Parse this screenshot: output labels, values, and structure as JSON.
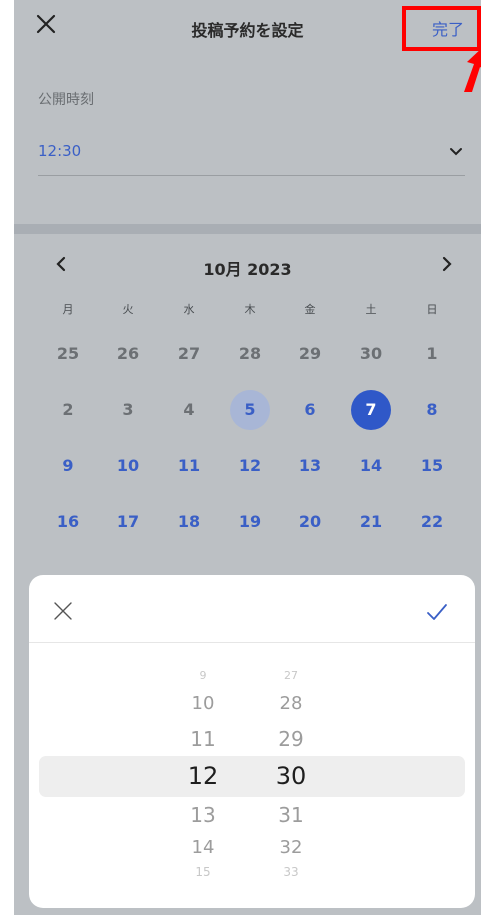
{
  "header": {
    "close_icon": "close-icon",
    "title": "投稿予約を設定",
    "done_label": "完了"
  },
  "publish": {
    "label": "公開時刻",
    "value": "12:30"
  },
  "calendar": {
    "month_label": "10月 2023",
    "weekdays": [
      "月",
      "火",
      "水",
      "木",
      "金",
      "土",
      "日"
    ],
    "weeks": [
      [
        "25",
        "26",
        "27",
        "28",
        "29",
        "30",
        "1"
      ],
      [
        "2",
        "3",
        "4",
        "5",
        "6",
        "7",
        "8"
      ],
      [
        "9",
        "10",
        "11",
        "12",
        "13",
        "14",
        "15"
      ],
      [
        "16",
        "17",
        "18",
        "19",
        "20",
        "21",
        "22"
      ]
    ],
    "today": "5",
    "selected": "7"
  },
  "time_picker": {
    "hours": [
      "9",
      "10",
      "11",
      "12",
      "13",
      "14",
      "15"
    ],
    "minutes": [
      "27",
      "28",
      "29",
      "30",
      "31",
      "32",
      "33"
    ],
    "selected_hour": "12",
    "selected_minute": "30"
  },
  "colors": {
    "accent": "#2f58c8",
    "link": "#3a5fc6",
    "highlight": "#ff0000"
  }
}
